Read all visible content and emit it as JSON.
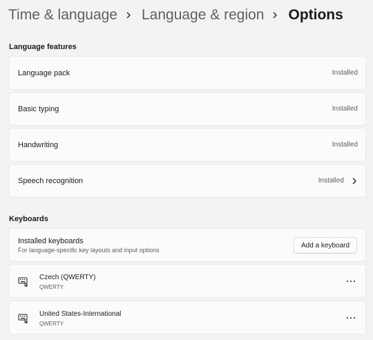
{
  "breadcrumb": {
    "items": [
      "Time & language",
      "Language & region"
    ],
    "current": "Options"
  },
  "language_features": {
    "header": "Language features",
    "items": [
      {
        "label": "Language pack",
        "status": "Installed"
      },
      {
        "label": "Basic typing",
        "status": "Installed"
      },
      {
        "label": "Handwriting",
        "status": "Installed"
      },
      {
        "label": "Speech recognition",
        "status": "Installed"
      }
    ]
  },
  "keyboards": {
    "header": "Keyboards",
    "installed": {
      "title": "Installed keyboards",
      "subtitle": "For language-specific key layouts and input options",
      "add_button": "Add a keyboard"
    },
    "list": [
      {
        "name": "Czech (QWERTY)",
        "layout": "QWERTY",
        "icon": "keyboard-icon"
      },
      {
        "name": "United States-International",
        "layout": "QWERTY",
        "icon": "keyboard-icon"
      }
    ]
  },
  "colors": {
    "accent": "#1b1b1b",
    "background": "#f3f3f3",
    "card": "#fbfbfb"
  }
}
